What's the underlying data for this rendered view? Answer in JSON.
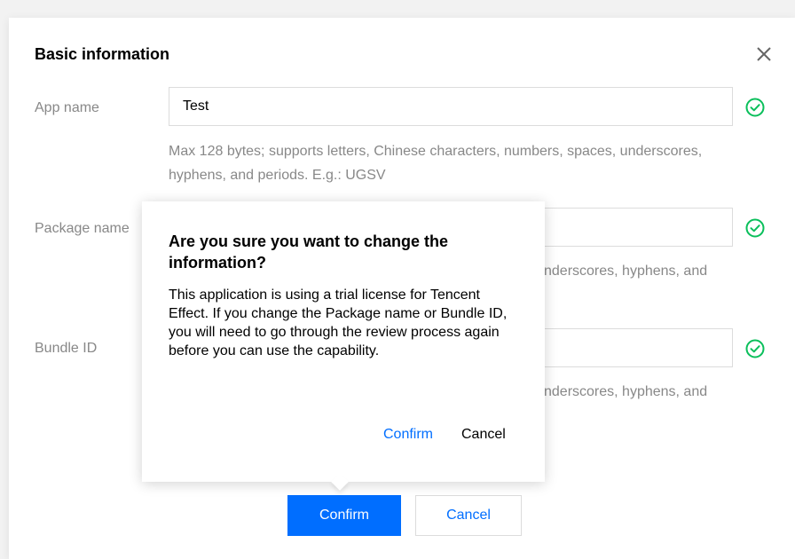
{
  "dialog": {
    "title": "Basic information",
    "close_icon": "close-icon"
  },
  "form": {
    "app_name": {
      "label": "App name",
      "value": "Test",
      "hint": "Max 128 bytes; supports letters, Chinese characters, numbers, spaces, underscores, hyphens, and periods. E.g.: UGSV"
    },
    "package_name": {
      "label": "Package name",
      "value": "",
      "hint_visible": "nderscores, hyphens, and"
    },
    "bundle_id": {
      "label": "Bundle ID",
      "value": "",
      "hint_visible": "nderscores, hyphens, and"
    },
    "valid_icon": "check-circle-icon"
  },
  "buttons": {
    "confirm_label": "Confirm",
    "cancel_label": "Cancel"
  },
  "popover": {
    "title": "Are you sure you want to change the information?",
    "body": "This application is using a trial license for Tencent Effect. If you change the Package name or Bundle ID, you will need to go through the review process again before you can use the capability.",
    "confirm_label": "Confirm",
    "cancel_label": "Cancel"
  },
  "colors": {
    "primary": "#006eff",
    "success": "#0abf5b",
    "muted_text": "#888888",
    "border": "#dcdcdc"
  }
}
